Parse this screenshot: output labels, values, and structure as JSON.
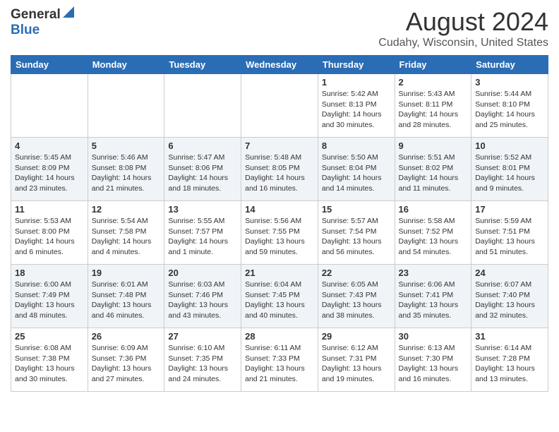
{
  "header": {
    "logo_general": "General",
    "logo_blue": "Blue",
    "month": "August 2024",
    "location": "Cudahy, Wisconsin, United States"
  },
  "weekdays": [
    "Sunday",
    "Monday",
    "Tuesday",
    "Wednesday",
    "Thursday",
    "Friday",
    "Saturday"
  ],
  "weeks": [
    [
      {
        "day": "",
        "info": ""
      },
      {
        "day": "",
        "info": ""
      },
      {
        "day": "",
        "info": ""
      },
      {
        "day": "",
        "info": ""
      },
      {
        "day": "1",
        "info": "Sunrise: 5:42 AM\nSunset: 8:13 PM\nDaylight: 14 hours\nand 30 minutes."
      },
      {
        "day": "2",
        "info": "Sunrise: 5:43 AM\nSunset: 8:11 PM\nDaylight: 14 hours\nand 28 minutes."
      },
      {
        "day": "3",
        "info": "Sunrise: 5:44 AM\nSunset: 8:10 PM\nDaylight: 14 hours\nand 25 minutes."
      }
    ],
    [
      {
        "day": "4",
        "info": "Sunrise: 5:45 AM\nSunset: 8:09 PM\nDaylight: 14 hours\nand 23 minutes."
      },
      {
        "day": "5",
        "info": "Sunrise: 5:46 AM\nSunset: 8:08 PM\nDaylight: 14 hours\nand 21 minutes."
      },
      {
        "day": "6",
        "info": "Sunrise: 5:47 AM\nSunset: 8:06 PM\nDaylight: 14 hours\nand 18 minutes."
      },
      {
        "day": "7",
        "info": "Sunrise: 5:48 AM\nSunset: 8:05 PM\nDaylight: 14 hours\nand 16 minutes."
      },
      {
        "day": "8",
        "info": "Sunrise: 5:50 AM\nSunset: 8:04 PM\nDaylight: 14 hours\nand 14 minutes."
      },
      {
        "day": "9",
        "info": "Sunrise: 5:51 AM\nSunset: 8:02 PM\nDaylight: 14 hours\nand 11 minutes."
      },
      {
        "day": "10",
        "info": "Sunrise: 5:52 AM\nSunset: 8:01 PM\nDaylight: 14 hours\nand 9 minutes."
      }
    ],
    [
      {
        "day": "11",
        "info": "Sunrise: 5:53 AM\nSunset: 8:00 PM\nDaylight: 14 hours\nand 6 minutes."
      },
      {
        "day": "12",
        "info": "Sunrise: 5:54 AM\nSunset: 7:58 PM\nDaylight: 14 hours\nand 4 minutes."
      },
      {
        "day": "13",
        "info": "Sunrise: 5:55 AM\nSunset: 7:57 PM\nDaylight: 14 hours\nand 1 minute."
      },
      {
        "day": "14",
        "info": "Sunrise: 5:56 AM\nSunset: 7:55 PM\nDaylight: 13 hours\nand 59 minutes."
      },
      {
        "day": "15",
        "info": "Sunrise: 5:57 AM\nSunset: 7:54 PM\nDaylight: 13 hours\nand 56 minutes."
      },
      {
        "day": "16",
        "info": "Sunrise: 5:58 AM\nSunset: 7:52 PM\nDaylight: 13 hours\nand 54 minutes."
      },
      {
        "day": "17",
        "info": "Sunrise: 5:59 AM\nSunset: 7:51 PM\nDaylight: 13 hours\nand 51 minutes."
      }
    ],
    [
      {
        "day": "18",
        "info": "Sunrise: 6:00 AM\nSunset: 7:49 PM\nDaylight: 13 hours\nand 48 minutes."
      },
      {
        "day": "19",
        "info": "Sunrise: 6:01 AM\nSunset: 7:48 PM\nDaylight: 13 hours\nand 46 minutes."
      },
      {
        "day": "20",
        "info": "Sunrise: 6:03 AM\nSunset: 7:46 PM\nDaylight: 13 hours\nand 43 minutes."
      },
      {
        "day": "21",
        "info": "Sunrise: 6:04 AM\nSunset: 7:45 PM\nDaylight: 13 hours\nand 40 minutes."
      },
      {
        "day": "22",
        "info": "Sunrise: 6:05 AM\nSunset: 7:43 PM\nDaylight: 13 hours\nand 38 minutes."
      },
      {
        "day": "23",
        "info": "Sunrise: 6:06 AM\nSunset: 7:41 PM\nDaylight: 13 hours\nand 35 minutes."
      },
      {
        "day": "24",
        "info": "Sunrise: 6:07 AM\nSunset: 7:40 PM\nDaylight: 13 hours\nand 32 minutes."
      }
    ],
    [
      {
        "day": "25",
        "info": "Sunrise: 6:08 AM\nSunset: 7:38 PM\nDaylight: 13 hours\nand 30 minutes."
      },
      {
        "day": "26",
        "info": "Sunrise: 6:09 AM\nSunset: 7:36 PM\nDaylight: 13 hours\nand 27 minutes."
      },
      {
        "day": "27",
        "info": "Sunrise: 6:10 AM\nSunset: 7:35 PM\nDaylight: 13 hours\nand 24 minutes."
      },
      {
        "day": "28",
        "info": "Sunrise: 6:11 AM\nSunset: 7:33 PM\nDaylight: 13 hours\nand 21 minutes."
      },
      {
        "day": "29",
        "info": "Sunrise: 6:12 AM\nSunset: 7:31 PM\nDaylight: 13 hours\nand 19 minutes."
      },
      {
        "day": "30",
        "info": "Sunrise: 6:13 AM\nSunset: 7:30 PM\nDaylight: 13 hours\nand 16 minutes."
      },
      {
        "day": "31",
        "info": "Sunrise: 6:14 AM\nSunset: 7:28 PM\nDaylight: 13 hours\nand 13 minutes."
      }
    ]
  ]
}
